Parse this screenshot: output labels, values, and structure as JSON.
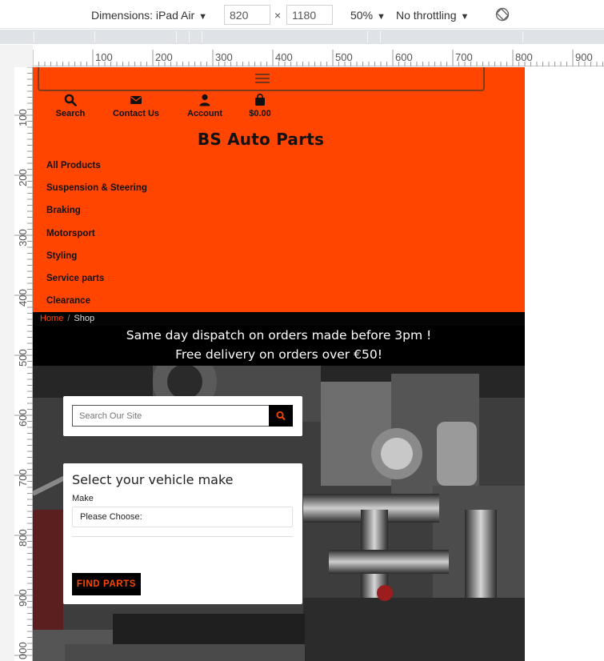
{
  "devtools": {
    "dimensions_label": "Dimensions: iPad Air",
    "width_value": "820",
    "height_value": "1180",
    "times": "×",
    "zoom": "50%",
    "throttling": "No throttling",
    "caret": "▼",
    "ruler_top_labels": [
      "100",
      "200",
      "300",
      "400",
      "500",
      "600",
      "700",
      "800",
      "900"
    ],
    "ruler_left_labels": [
      "100",
      "200",
      "300",
      "400",
      "500",
      "600",
      "700",
      "800",
      "900",
      "000"
    ]
  },
  "site": {
    "brand_color": "#ff4500",
    "quick_links": [
      {
        "label": "Search",
        "icon": "search-icon"
      },
      {
        "label": "Contact Us",
        "icon": "envelope-icon"
      },
      {
        "label": "Account",
        "icon": "user-icon"
      },
      {
        "label": "$0.00",
        "icon": "shopping-bag-icon"
      }
    ],
    "brand": "BS Auto Parts",
    "nav": [
      "All Products",
      "Suspension & Steering",
      "Braking",
      "Motorsport",
      "Styling",
      "Service parts",
      "Clearance"
    ],
    "breadcrumb": {
      "home": "Home",
      "separator": "/",
      "current": "Shop"
    },
    "promo": {
      "line1": "Same day dispatch on orders made before 3pm !",
      "line2": "Free delivery on orders over €50!"
    },
    "search": {
      "placeholder": "Search Our Site"
    },
    "vehicle": {
      "title": "Select your vehicle make",
      "make_label": "Make",
      "make_value": "Please Choose:",
      "button": "FIND PARTS"
    }
  }
}
